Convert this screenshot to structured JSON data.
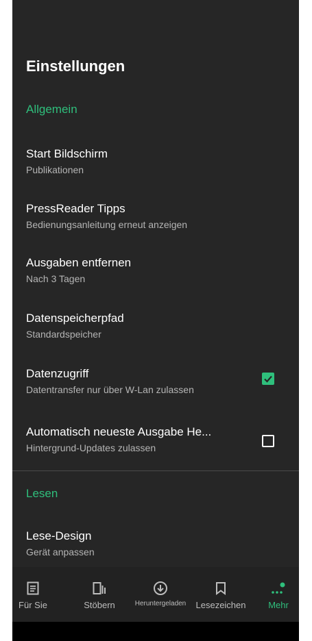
{
  "header": {
    "title": "Einstellungen"
  },
  "sections": [
    {
      "label": "Allgemein"
    },
    {
      "label": "Lesen"
    }
  ],
  "settings": [
    {
      "title": "Start Bildschirm",
      "subtitle": "Publikationen"
    },
    {
      "title": "PressReader Tipps",
      "subtitle": "Bedienungsanleitung erneut anzeigen"
    },
    {
      "title": "Ausgaben entfernen",
      "subtitle": "Nach 3 Tagen"
    },
    {
      "title": "Datenspeicherpfad",
      "subtitle": "Standardspeicher"
    },
    {
      "title": "Datenzugriff",
      "subtitle": "Datentransfer nur über W-Lan zulassen",
      "checked": true
    },
    {
      "title": "Automatisch neueste Ausgabe He...",
      "subtitle": "Hintergrund-Updates zulassen",
      "checked": false
    },
    {
      "title": "Lese-Design",
      "subtitle": "Gerät anpassen"
    }
  ],
  "nav": [
    {
      "label": "Für Sie",
      "icon": "for-you-icon"
    },
    {
      "label": "Stöbern",
      "icon": "browse-icon"
    },
    {
      "label": "Heruntergeladen",
      "icon": "download-icon"
    },
    {
      "label": "Lesezeichen",
      "icon": "bookmark-icon"
    },
    {
      "label": "Mehr",
      "icon": "more-icon",
      "active": true
    }
  ],
  "colors": {
    "accent": "#2fbf7c",
    "background": "#262626"
  }
}
